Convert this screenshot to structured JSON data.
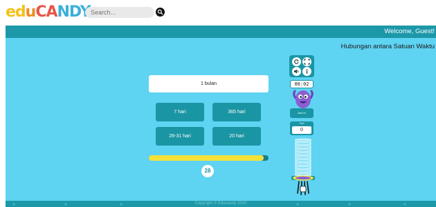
{
  "header": {
    "logo_parts": [
      "ed",
      "u",
      "CA",
      "NDY"
    ],
    "search": {
      "placeholder": "Search...",
      "value": ""
    },
    "search_icon": "search-icon"
  },
  "nav": {
    "welcome": "Welcome, Guest!"
  },
  "activity": {
    "title": "Hubungan antara Satuan Waktu",
    "question": "1 bulan",
    "answers": [
      "7 hari",
      "365 hari",
      "28-31 hari",
      "20 hari"
    ],
    "progress": 0.96,
    "counter": "28"
  },
  "controls": {
    "buttons": [
      "restart-icon",
      "fullscreen-icon",
      "sound-icon",
      "info-icon"
    ],
    "timer": "00:02",
    "mascot_label": "Saat Ini",
    "score_label": "Poin",
    "score": "0"
  },
  "footer": {
    "copyright": "Copyright © Educandy 2020"
  },
  "colors": {
    "nav_teal": "#1c98a8",
    "stage_blue": "#5fd3f2",
    "button_teal": "#1a95a4",
    "progress_yellow": "#f4e23a",
    "mascot_purple": "#8a5fd0"
  }
}
